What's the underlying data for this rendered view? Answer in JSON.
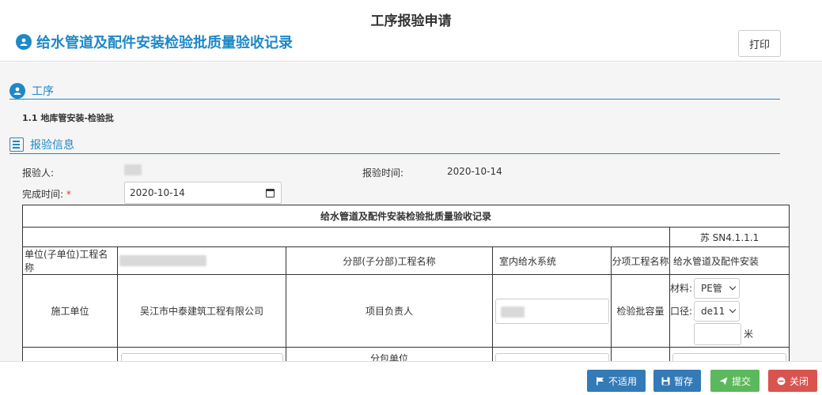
{
  "header": {
    "page_title": "工序报验申请",
    "sub_title": "给水管道及配件安装检验批质量验收记录",
    "print_label": "打印"
  },
  "process_section": {
    "title": "工序",
    "item": "1.1 地库管安装-检验批"
  },
  "info_section": {
    "title": "报验信息",
    "reporter_label": "报验人:",
    "report_time_label": "报验时间:",
    "report_time_value": "2020-10-14",
    "finish_time_label": "完成时间:",
    "required_mark": "*",
    "finish_time_value": "2020-10-14"
  },
  "record_table": {
    "title": "给水管道及配件安装检验批质量验收记录",
    "code": "苏 SN4.1.1.1",
    "unit_project_label": "单位(子单位)工程名称",
    "division_label": "分部(子分部)工程名称",
    "division_value": "室内给水系统",
    "subitem_label": "分项工程名称",
    "subitem_value": "给水管道及配件安装",
    "construction_unit_label": "施工单位",
    "construction_unit_value": "吴江市中泰建筑工程有限公司",
    "project_leader_label": "项目负责人",
    "batch_capacity_label": "检验批容量",
    "material_label": "材料:",
    "material_value": "PE管",
    "caliber_label": "口径:",
    "caliber_value": "de11",
    "meter_unit": "米",
    "subcontract_label": "分包单位"
  },
  "footer": {
    "not_applicable": "不适用",
    "save_draft": "暂存",
    "submit": "提交",
    "close": "关闭"
  },
  "colors": {
    "accent": "#1e88c7",
    "btn_blue": "#337ab7",
    "btn_green": "#5cb85c",
    "btn_red": "#d9534f"
  }
}
